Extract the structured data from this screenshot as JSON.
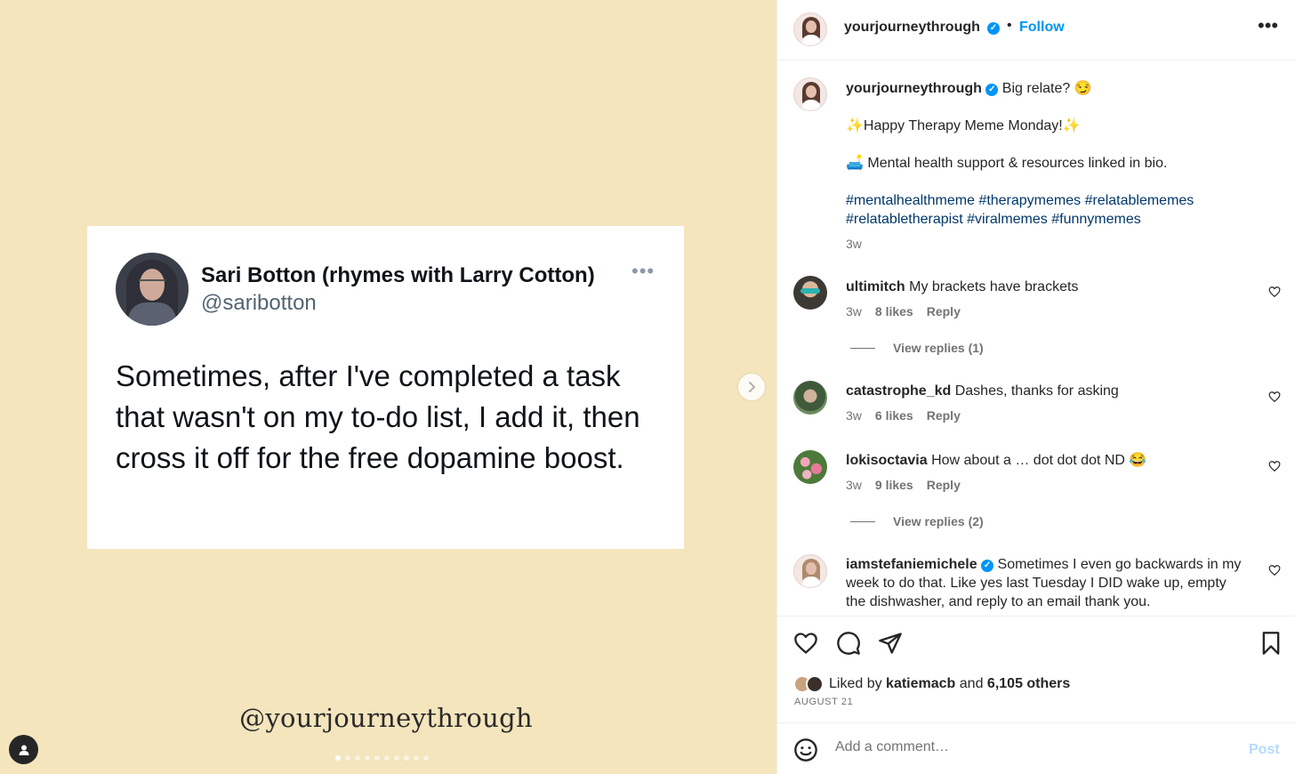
{
  "media": {
    "tweet": {
      "name": "Sari Botton (rhymes with Larry Cotton)",
      "handle": "@saribotton",
      "text": "Sometimes, after I've completed a task that wasn't on my to-do list, I add it, then cross it off for the free dopamine boost."
    },
    "watermark": "@yourjourneythrough",
    "carousel": {
      "total": 10,
      "current": 1
    }
  },
  "header": {
    "username": "yourjourneythrough",
    "dot": "•",
    "follow_label": "Follow",
    "more_label": "•••"
  },
  "caption": {
    "username": "yourjourneythrough",
    "line1": "Big relate? 😏",
    "line2": "✨Happy Therapy Meme Monday!✨",
    "line3": "🛋️ Mental health support & resources linked in bio.",
    "hashtags_line1": "#mentalhealthmeme #therapymemes #relatablememes",
    "hashtags_line2": "#relatabletherapist #viralmemes #funnymemes",
    "age": "3w"
  },
  "comments": [
    {
      "username": "ultimitch",
      "text": "My brackets have brackets",
      "age": "3w",
      "likes": "8 likes",
      "reply": "Reply",
      "view_replies": "View replies (1)"
    },
    {
      "username": "catastrophe_kd",
      "text": "Dashes, thanks for asking",
      "age": "3w",
      "likes": "6 likes",
      "reply": "Reply"
    },
    {
      "username": "lokisoctavia",
      "text": "How about a … dot dot dot ND 😂",
      "age": "3w",
      "likes": "9 likes",
      "reply": "Reply",
      "view_replies": "View replies (2)"
    },
    {
      "username": "iamstefaniemichele",
      "text": "Sometimes I even go backwards in my week to do that. Like yes last Tuesday I DID wake up, empty the dishwasher, and reply to an email thank you."
    }
  ],
  "actions": {
    "liked_by_prefix": "Liked by",
    "liked_by_user": "katiemacb",
    "liked_by_and": "and",
    "liked_by_others": "6,105 others",
    "date": "AUGUST 21"
  },
  "comment_box": {
    "placeholder": "Add a comment…",
    "post_label": "Post"
  },
  "colors": {
    "accent": "#0095f6",
    "media_bg": "#f4e5bd",
    "hashtag": "#00376b"
  },
  "icons": [
    "tags-user-icon",
    "chevron-right-icon",
    "heart-icon",
    "comment-icon",
    "share-icon",
    "bookmark-icon",
    "emoji-icon",
    "verified-badge-icon",
    "more-options-icon"
  ]
}
